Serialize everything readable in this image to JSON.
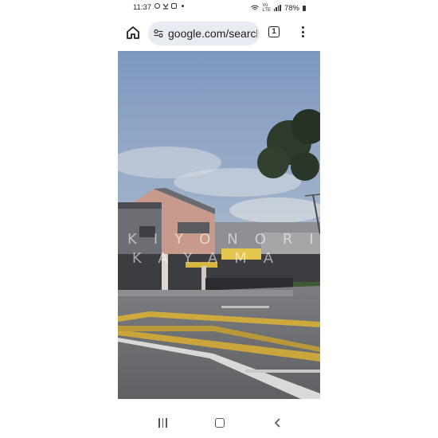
{
  "status_bar": {
    "time": "11:37",
    "notification_icons": [
      "whatsapp-icon",
      "missed-call-icon",
      "gallery-icon"
    ],
    "battery": "78%"
  },
  "browser": {
    "url": "google.com/search",
    "tab_count": "1"
  },
  "image": {
    "watermark_line1": "KIYONORI",
    "watermark_line2": "TAKAYAMA"
  },
  "nav_bar": {
    "buttons": [
      "recents-button",
      "home-button",
      "back-button"
    ]
  }
}
